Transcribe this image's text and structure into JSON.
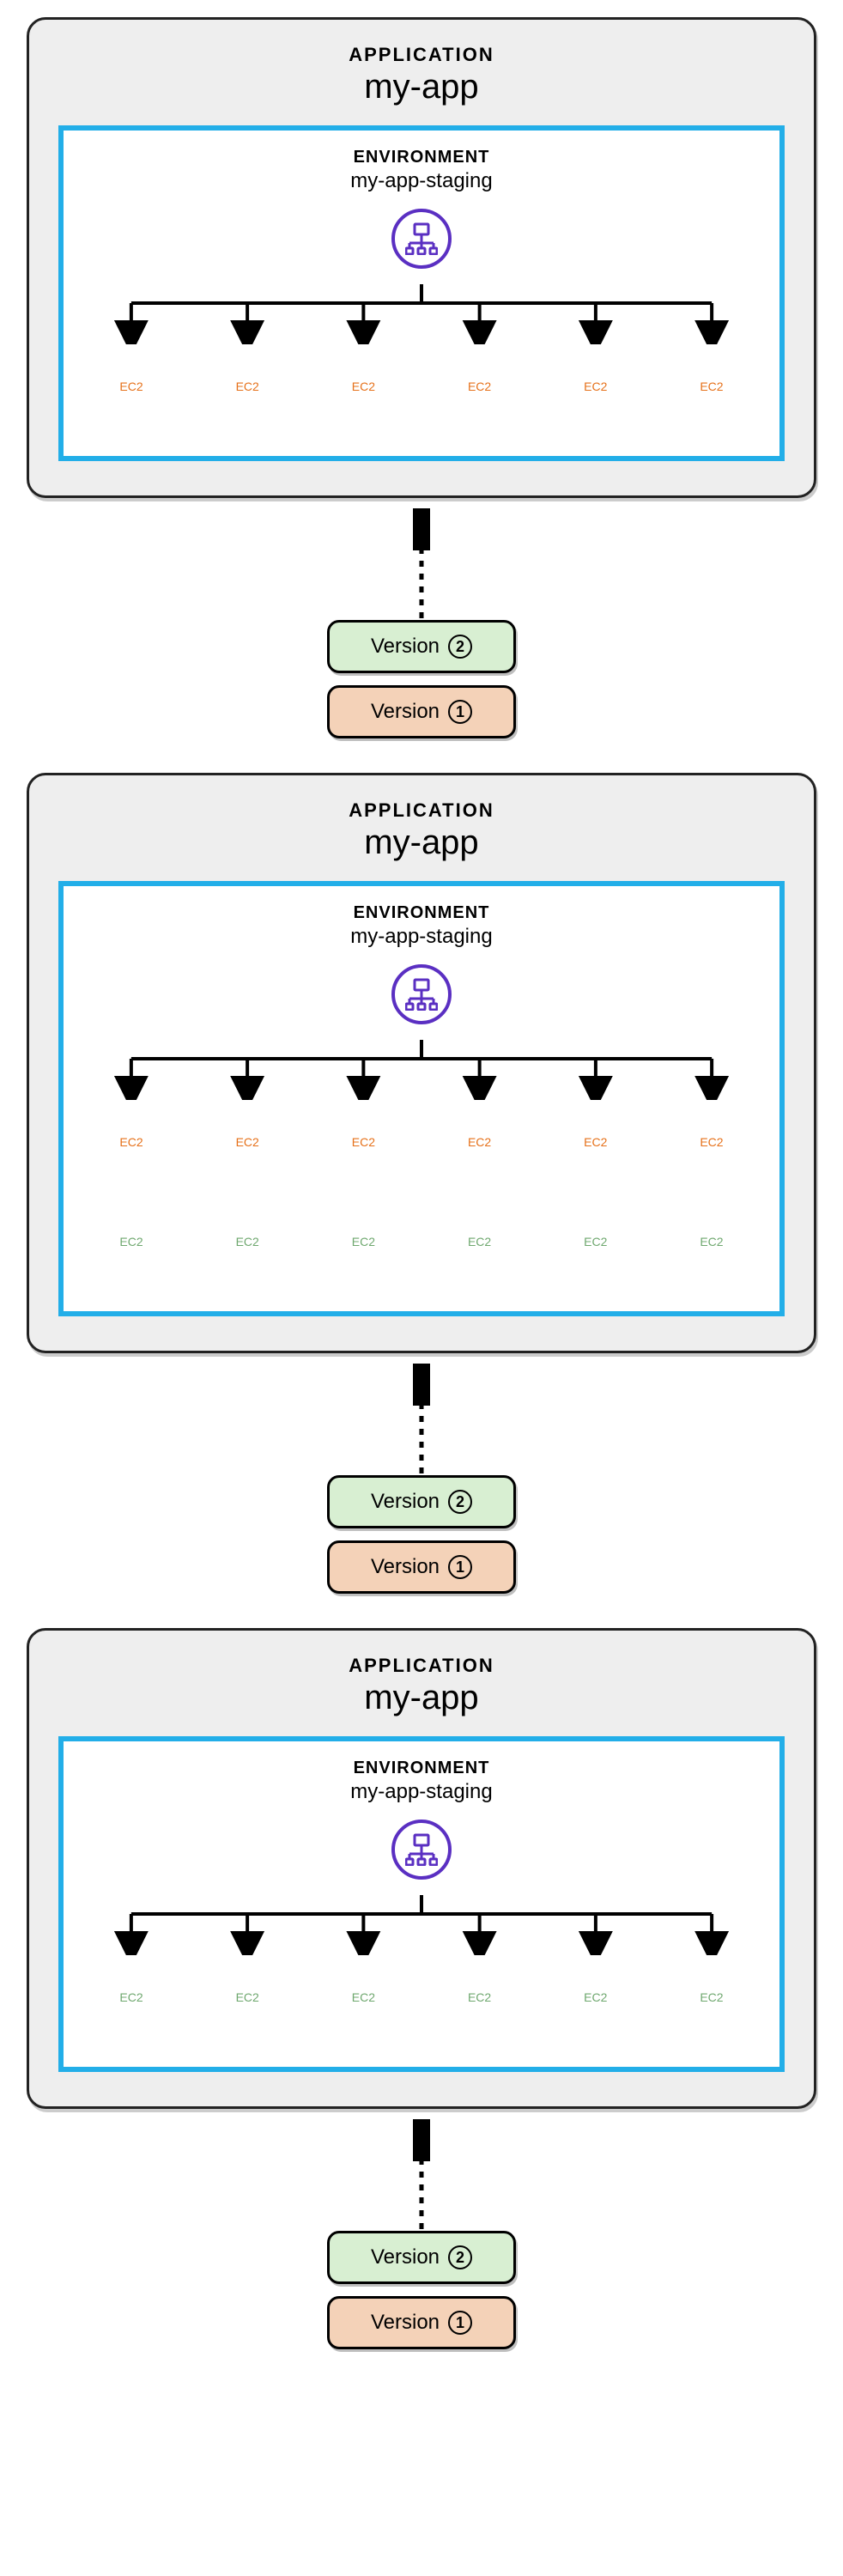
{
  "labels": {
    "application": "APPLICATION",
    "environment": "ENVIRONMENT"
  },
  "app_name": "my-app",
  "env_name": "my-app-staging",
  "ec2_label": "EC2",
  "version_word": "Version",
  "versions": [
    {
      "num": "2",
      "color": "green"
    },
    {
      "num": "1",
      "color": "orange"
    }
  ],
  "stages": [
    {
      "rows": [
        {
          "count": 6,
          "color": "orange",
          "connected": true
        }
      ]
    },
    {
      "rows": [
        {
          "count": 6,
          "color": "orange",
          "connected": true
        },
        {
          "count": 6,
          "color": "green",
          "connected": false
        }
      ]
    },
    {
      "rows": [
        {
          "count": 6,
          "color": "green",
          "connected": true
        }
      ]
    }
  ],
  "colors": {
    "env_border": "#22aee8",
    "lb_purple": "#5a2fc2",
    "ec2_orange": "#e6711a",
    "ec2_green": "#6fa86f",
    "version_green_bg": "#d8efd2",
    "version_orange_bg": "#f4d2b8"
  }
}
